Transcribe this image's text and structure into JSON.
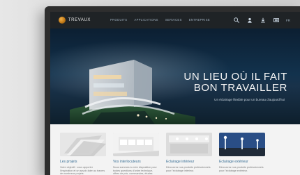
{
  "brand": {
    "name": "TREVAUX"
  },
  "nav": {
    "items": [
      "PRODUITS",
      "APPLICATIONS",
      "SERVICES",
      "ENTREPRISE"
    ],
    "language": "FR"
  },
  "search": {
    "placeholder": "Recherche"
  },
  "hero": {
    "line1": "UN LIEU OÙ IL FAIT",
    "line2": "BON TRAVAILLER",
    "subtitle": "Un éclairage flexible pour un bureau d'aujourd'hui"
  },
  "cards": [
    {
      "title": "Les projets",
      "text": "Votre objectif : vous apporter l'inspiration et un savoir-faire au travers de nombreux projets."
    },
    {
      "title": "Vos interlocuteurs",
      "text": "Nous sommes à votre disposition pour toutes questions d'ordre technique, offres de prix, commandes, études d'éclairage."
    },
    {
      "title": "Eclairage intérieur",
      "text": "Découvrez nos produits professionnels pour l'éclairage intérieur."
    },
    {
      "title": "Eclairage extérieur",
      "text": "Découvrez nos produits professionnels pour l'éclairage extérieur."
    }
  ],
  "icons": {
    "search": "search-icon",
    "user": "user-icon",
    "download": "download-icon",
    "compare": "compare-icon"
  },
  "colors": {
    "topnav": "#1f2326",
    "search_bar": "#0b97d8",
    "card_title": "#3a6f95"
  }
}
